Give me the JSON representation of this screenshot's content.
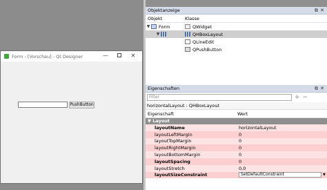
{
  "form_window": {
    "title": "Form - [Vorschau] - Qt Designer",
    "push_button": "PushButton",
    "line_edit_value": ""
  },
  "object_inspector": {
    "title": "Objektanzeige",
    "col_object": "Objekt",
    "col_class": "Klasse",
    "rows": [
      {
        "object": "Form",
        "class": "QWidget"
      },
      {
        "object": "",
        "class": "QHBoxLayout"
      },
      {
        "object": "",
        "class": "QLineEdit"
      },
      {
        "object": "",
        "class": "QPushButton"
      }
    ]
  },
  "property_editor": {
    "title": "Eigenschaften",
    "filter_placeholder": "Filter",
    "object_line": "horizontalLayout : QHBoxLayout",
    "col_property": "Eigenschaft",
    "col_value": "Wert",
    "section": "Layout",
    "rows": [
      {
        "name": "layoutName",
        "value": "horizontalLayout"
      },
      {
        "name": "layoutLeftMargin",
        "value": "0"
      },
      {
        "name": "layoutTopMargin",
        "value": "0"
      },
      {
        "name": "layoutRightMargin",
        "value": "0"
      },
      {
        "name": "layoutBottomMargin",
        "value": "0"
      },
      {
        "name": "layoutSpacing",
        "value": "0"
      },
      {
        "name": "layoutStretch",
        "value": "0,0"
      },
      {
        "name": "layoutSizeConstraint",
        "value": "SetDefaultConstraint"
      }
    ]
  },
  "icons": {
    "float": "float-icon",
    "close": "close-icon",
    "plus": "plus-icon",
    "minus": "minus-icon"
  }
}
